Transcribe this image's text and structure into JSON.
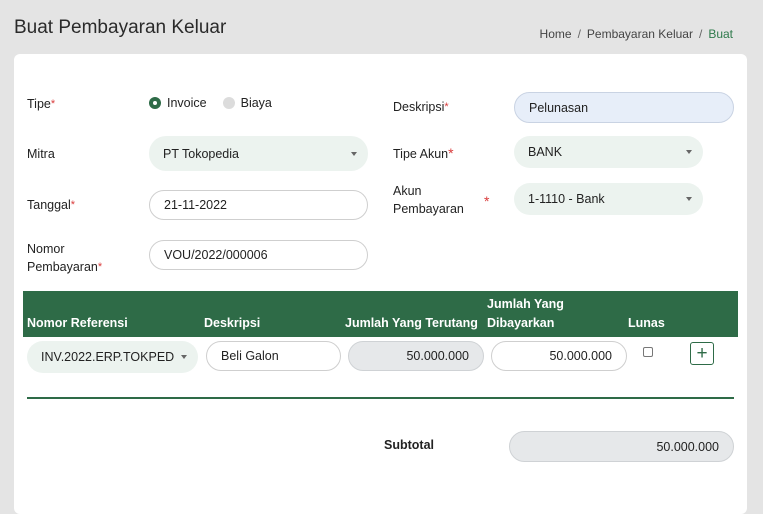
{
  "page": {
    "title": "Buat Pembayaran Keluar"
  },
  "breadcrumb": {
    "items": [
      "Home",
      "Pembayaran Keluar",
      "Buat"
    ],
    "separator": "/"
  },
  "form": {
    "tipe": {
      "label": "Tipe",
      "options": [
        "Invoice",
        "Biaya"
      ],
      "selected": "Invoice"
    },
    "mitra": {
      "label": "Mitra",
      "value": "PT Tokopedia"
    },
    "tanggal": {
      "label": "Tanggal",
      "value": "21-11-2022"
    },
    "nomor": {
      "label_line1": "Nomor",
      "label_line2": "Pembayaran",
      "value": "VOU/2022/000006"
    },
    "deskripsi": {
      "label": "Deskripsi",
      "value": "Pelunasan"
    },
    "tipe_akun": {
      "label": "Tipe Akun",
      "value": "BANK"
    },
    "akun": {
      "label_line1": "Akun",
      "label_line2": "Pembayaran",
      "value": "1-1110 - Bank"
    },
    "required_mark": "*"
  },
  "table": {
    "headers": {
      "nomor_referensi": "Nomor Referensi",
      "deskripsi": "Deskripsi",
      "jumlah_terutang": "Jumlah Yang Terutang",
      "jumlah_dibayarkan_1": "Jumlah Yang",
      "jumlah_dibayarkan_2": "Dibayarkan",
      "lunas": "Lunas"
    },
    "rows": [
      {
        "nomor_referensi": "INV.2022.ERP.TOKPED",
        "deskripsi": "Beli Galon",
        "jumlah_terutang": "50.000.000",
        "jumlah_dibayarkan": "50.000.000",
        "lunas": false
      }
    ],
    "add_label": "+"
  },
  "summary": {
    "subtotal_label": "Subtotal",
    "subtotal_value": "50.000.000"
  },
  "colors": {
    "primary": "#2e6b47",
    "required": "#d93b3b",
    "select_bg": "#ecf3ef"
  }
}
